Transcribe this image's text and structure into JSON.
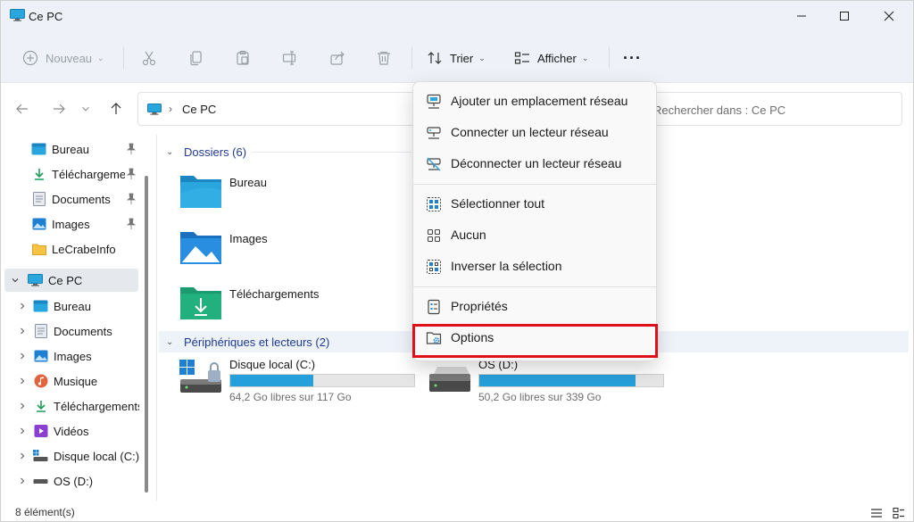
{
  "window": {
    "title": "Ce PC",
    "controls": [
      "minimize-icon",
      "maximize-icon",
      "close-icon"
    ]
  },
  "toolbar": {
    "new_label": "Nouveau",
    "sort_label": "Trier",
    "view_label": "Afficher",
    "more_glyph": "···",
    "icons": [
      "plus-circle-icon",
      "cut-icon",
      "copy-icon",
      "paste-icon",
      "rename-icon",
      "share-icon",
      "trash-icon",
      "sort-icon",
      "view-icon",
      "more-icon"
    ]
  },
  "address": {
    "crumb": "Ce PC",
    "crumb_separator": "›",
    "search_placeholder": "Rechercher dans : Ce PC"
  },
  "sidebar": {
    "quick_access": [
      {
        "label": "Bureau",
        "icon": "desktop-folder-icon",
        "pinned": true
      },
      {
        "label": "Téléchargements",
        "icon": "download-icon",
        "pinned": true
      },
      {
        "label": "Documents",
        "icon": "documents-icon",
        "pinned": true
      },
      {
        "label": "Images",
        "icon": "images-icon",
        "pinned": true
      },
      {
        "label": "LeCrabeInfo",
        "icon": "folder-icon",
        "pinned": false
      }
    ],
    "this_pc": {
      "label": "Ce PC",
      "icon": "pc-icon"
    },
    "this_pc_children": [
      {
        "label": "Bureau",
        "icon": "desktop-folder-icon"
      },
      {
        "label": "Documents",
        "icon": "documents-icon"
      },
      {
        "label": "Images",
        "icon": "images-icon"
      },
      {
        "label": "Musique",
        "icon": "music-icon"
      },
      {
        "label": "Téléchargements",
        "icon": "download-icon"
      },
      {
        "label": "Vidéos",
        "icon": "videos-icon"
      },
      {
        "label": "Disque local (C:)",
        "icon": "drive-c-icon"
      },
      {
        "label": "OS (D:)",
        "icon": "drive-icon"
      }
    ]
  },
  "main": {
    "folders_header": "Dossiers (6)",
    "folders": [
      {
        "name": "Bureau",
        "icon": "desktop-folder-icon"
      },
      {
        "name": "Images",
        "icon": "images-folder-icon"
      },
      {
        "name": "Téléchargements",
        "icon": "downloads-folder-icon"
      }
    ],
    "devices_header": "Périphériques et lecteurs (2)",
    "drives": [
      {
        "name": "Disque local (C:)",
        "free": "64,2 Go libres sur 117 Go",
        "used_fraction": 0.45,
        "icon": "system-drive-icon"
      },
      {
        "name": "OS (D:)",
        "free": "50,2 Go libres sur 339 Go",
        "used_fraction": 0.85,
        "icon": "drive-icon"
      }
    ]
  },
  "menu": {
    "items": [
      {
        "label": "Ajouter un emplacement réseau",
        "icon": "network-location-icon"
      },
      {
        "label": "Connecter un lecteur réseau",
        "icon": "map-network-drive-icon"
      },
      {
        "label": "Déconnecter un lecteur réseau",
        "icon": "disconnect-network-drive-icon"
      },
      {
        "label": "Sélectionner tout",
        "icon": "select-all-icon"
      },
      {
        "label": "Aucun",
        "icon": "select-none-icon"
      },
      {
        "label": "Inverser la sélection",
        "icon": "invert-selection-icon"
      },
      {
        "label": "Propriétés",
        "icon": "properties-icon"
      },
      {
        "label": "Options",
        "icon": "options-icon"
      }
    ],
    "highlighted_item": "Options",
    "highlight_color": "#e0101a"
  },
  "status": {
    "count": "8 élément(s)"
  },
  "colors": {
    "accent": "#26a0da",
    "chrome": "#eef2f8",
    "group_header": "#1f3a93"
  }
}
